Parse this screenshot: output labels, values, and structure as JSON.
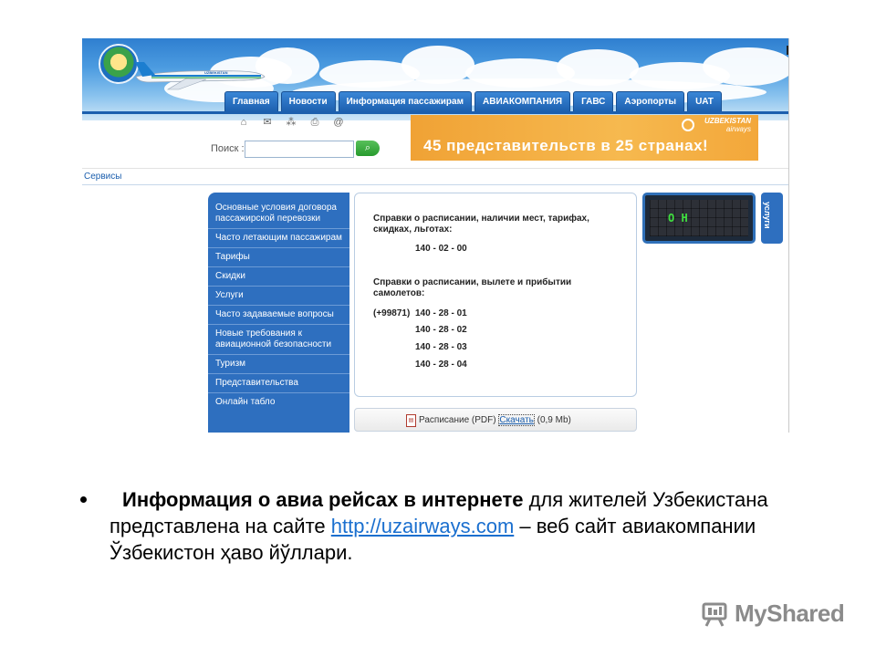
{
  "nav": {
    "items": [
      "Главная",
      "Новости",
      "Информация пассажирам",
      "АВИАКОМПАНИЯ",
      "ГАВС",
      "Аэропорты",
      "UAT"
    ]
  },
  "toolbar_icons": [
    "home-icon",
    "mail-icon",
    "sitemap-icon",
    "print-icon",
    "at-icon"
  ],
  "search": {
    "label": "Поиск :",
    "placeholder": "",
    "button_icon": "search-icon"
  },
  "ad": {
    "text": "45 представительств в 25 странах!",
    "brand": "UZBEKISTAN",
    "brand_sub": "airways"
  },
  "plane_livery": "UZBEKISTAN",
  "breadcrumb": "Сервисы",
  "menu": {
    "items": [
      "Основные условия договора пассажирской перевозки",
      "Часто летающим пассажирам",
      "Тарифы",
      "Скидки",
      "Услуги",
      "Часто задаваемые вопросы",
      "Новые требования к авиационной безопасности",
      "Туризм",
      "Представительства",
      "Онлайн табло"
    ]
  },
  "panel": {
    "heading1": "Справки о расписании, наличии мест, тарифах, скидках, льготах:",
    "phone1": "140 - 02 - 00",
    "heading2": "Справки о расписании, вылете и прибытии самолетов:",
    "prefix": "(+99871)",
    "phones2": [
      "140 - 28 - 01",
      "140 - 28 - 02",
      "140 - 28 - 03",
      "140 - 28 - 04"
    ]
  },
  "download": {
    "label": "Расписание (PDF)",
    "link": "Скачать",
    "size": "(0,9 Mb)"
  },
  "board": {
    "text": "O H"
  },
  "services_tab": "услуги",
  "caption": {
    "bold": "Информация о авиа рейсах в интернете",
    "text1": " для жителей Узбекистана представлена на сайте ",
    "link": "http://uzairways.com",
    "text2": " – веб сайт авиакомпании Ўзбекистон ҳаво йўллари."
  },
  "watermark": "MyShared",
  "colors": {
    "menu_blue": "#2e6fbf",
    "ad_orange": "#f6b94f",
    "link_blue": "#1a6fcf",
    "board_green": "#3fe03f"
  }
}
